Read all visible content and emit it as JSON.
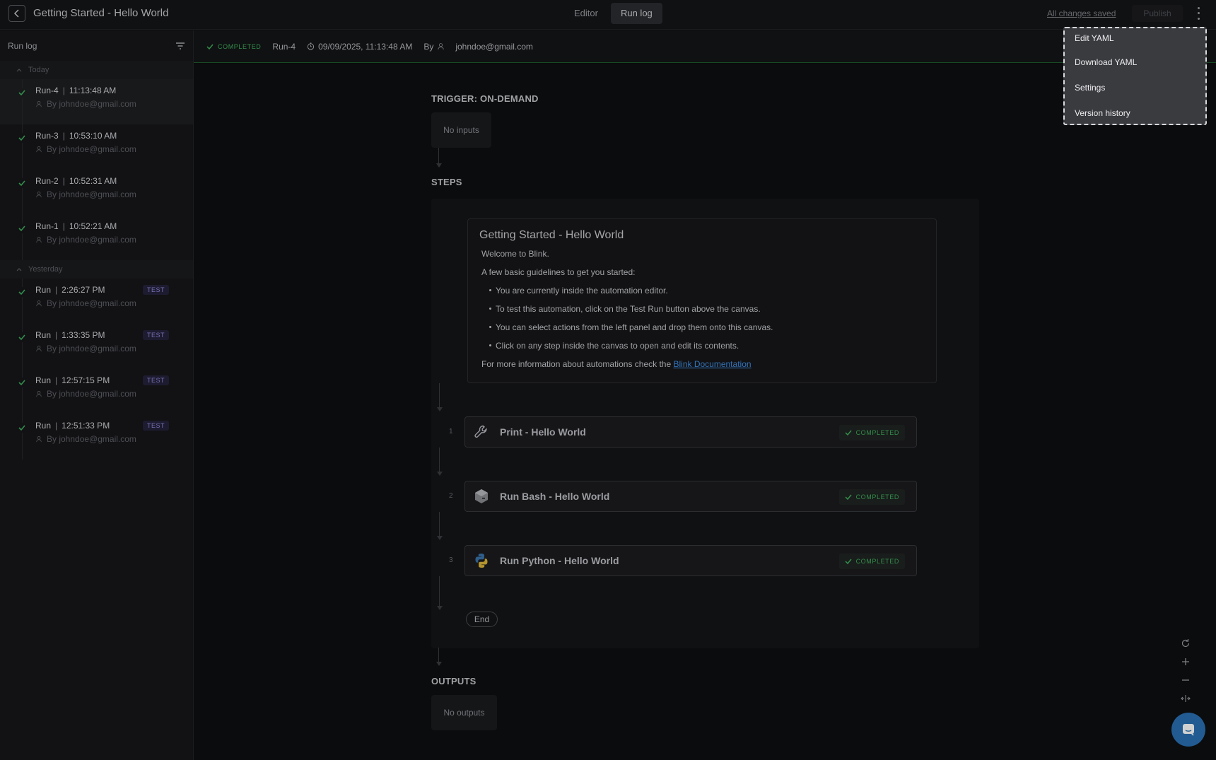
{
  "header": {
    "title": "Getting Started - Hello World",
    "tabs": [
      {
        "label": "Editor",
        "active": false
      },
      {
        "label": "Run log",
        "active": true
      }
    ],
    "save_status": "All changes saved",
    "publish_label": "Publish"
  },
  "sidebar": {
    "title": "Run log",
    "groups": [
      {
        "label": "Today",
        "runs": [
          {
            "name": "Run-4",
            "time": "11:13:48 AM",
            "by": "By johndoe@gmail.com",
            "test": false,
            "selected": true
          },
          {
            "name": "Run-3",
            "time": "10:53:10 AM",
            "by": "By johndoe@gmail.com",
            "test": false,
            "selected": false
          },
          {
            "name": "Run-2",
            "time": "10:52:31 AM",
            "by": "By johndoe@gmail.com",
            "test": false,
            "selected": false
          },
          {
            "name": "Run-1",
            "time": "10:52:21 AM",
            "by": "By johndoe@gmail.com",
            "test": false,
            "selected": false
          }
        ]
      },
      {
        "label": "Yesterday",
        "runs": [
          {
            "name": "Run",
            "time": "2:26:27 PM",
            "by": "By johndoe@gmail.com",
            "test": true,
            "selected": false
          },
          {
            "name": "Run",
            "time": "1:33:35 PM",
            "by": "By johndoe@gmail.com",
            "test": true,
            "selected": false
          },
          {
            "name": "Run",
            "time": "12:57:15 PM",
            "by": "By johndoe@gmail.com",
            "test": true,
            "selected": false
          },
          {
            "name": "Run",
            "time": "12:51:33 PM",
            "by": "By johndoe@gmail.com",
            "test": true,
            "selected": false
          }
        ]
      }
    ],
    "test_badge": "TEST"
  },
  "run_strip": {
    "status": "COMPLETED",
    "run_name": "Run-4",
    "timestamp": "09/09/2025, 11:13:48 AM",
    "by_label": "By",
    "user": "johndoe@gmail.com"
  },
  "canvas": {
    "trigger_label": "TRIGGER: ON-DEMAND",
    "no_inputs": "No inputs",
    "steps_label": "STEPS",
    "note": {
      "title": "Getting Started - Hello World",
      "welcome": "Welcome to Blink.",
      "intro": "A few basic guidelines to get you started:",
      "bullets": [
        "You are currently inside the automation editor.",
        "To test this automation, click on the Test Run button above the canvas.",
        "You can select actions from the left panel and drop them onto this canvas.",
        "Click on any step inside the canvas to open and edit its contents."
      ],
      "more_info": "For more information about automations check the ",
      "link": "Blink Documentation"
    },
    "steps": [
      {
        "num": "1",
        "name": "Print - Hello World",
        "status": "COMPLETED",
        "icon": "wrench-icon"
      },
      {
        "num": "2",
        "name": "Run Bash - Hello World",
        "status": "COMPLETED",
        "icon": "bash-icon"
      },
      {
        "num": "3",
        "name": "Run Python - Hello World",
        "status": "COMPLETED",
        "icon": "python-icon"
      }
    ],
    "end_label": "End",
    "outputs_label": "OUTPUTS",
    "no_outputs": "No outputs"
  },
  "menu": {
    "items": [
      "Edit YAML",
      "Download YAML",
      "Settings",
      "Version history"
    ]
  },
  "colors": {
    "success": "#3fae5d",
    "link": "#3f8ee6",
    "chat": "#2a6fb3",
    "test_badge": "#8e87d8"
  }
}
